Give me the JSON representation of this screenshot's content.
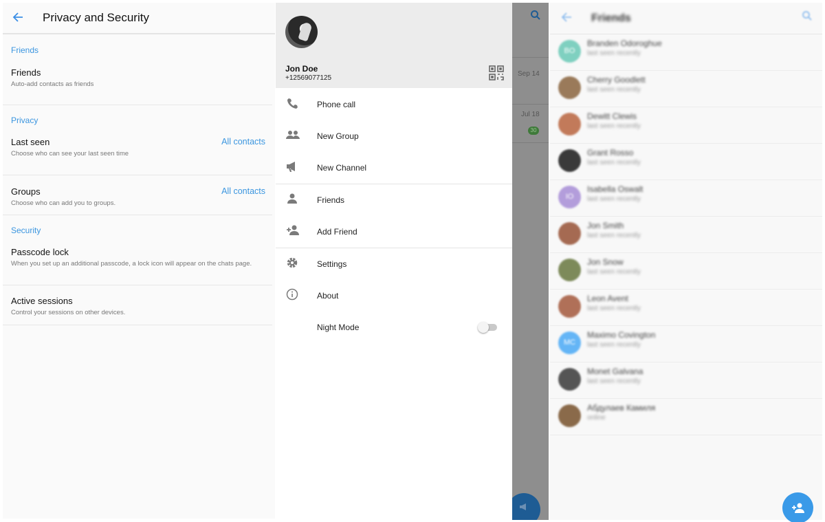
{
  "privacy": {
    "title": "Privacy and Security",
    "sections": [
      {
        "label": "Friends"
      },
      {
        "label": "Privacy"
      },
      {
        "label": "Security"
      }
    ],
    "rows": [
      {
        "title": "Friends",
        "subtitle": "Auto-add contacts as friends",
        "value": ""
      },
      {
        "title": "Last seen",
        "subtitle": "Choose who can see your last seen time",
        "value": "All contacts"
      },
      {
        "title": "Groups",
        "subtitle": "Choose who can add you to groups.",
        "value": "All contacts"
      },
      {
        "title": "Passcode lock",
        "subtitle": "When you set up an additional passcode, a lock icon will appear on the chats page.",
        "value": ""
      },
      {
        "title": "Active sessions",
        "subtitle": "Control your sessions on other devices.",
        "value": ""
      }
    ],
    "accent_color": "#3a95df"
  },
  "drawer": {
    "user_name": "Jon Doe",
    "user_phone": "+12569077125",
    "items": [
      {
        "label": "Phone call",
        "icon": "phone-icon"
      },
      {
        "label": "New Group",
        "icon": "group-icon"
      },
      {
        "label": "New Channel",
        "icon": "megaphone-icon"
      },
      {
        "label": "Friends",
        "icon": "person-icon"
      },
      {
        "label": "Add Friend",
        "icon": "add-person-icon"
      },
      {
        "label": "Settings",
        "icon": "gear-icon"
      },
      {
        "label": "About",
        "icon": "info-icon"
      },
      {
        "label": "Night Mode",
        "icon": "moon-icon"
      }
    ],
    "night_mode_on": false,
    "background_chat": {
      "dates": [
        "Sep 14",
        "Jul 18"
      ],
      "badge": "30"
    }
  },
  "friends": {
    "title": "Friends",
    "items": [
      {
        "name": "Branden Odoroghue",
        "status": "last seen recently",
        "initials": "BO",
        "color": "#7fd0c0"
      },
      {
        "name": "Cherry Goodlett",
        "status": "last seen recently",
        "initials": "",
        "color": "#9a7a5a"
      },
      {
        "name": "Dewitt Clewis",
        "status": "last seen recently",
        "initials": "",
        "color": "#c27a5a"
      },
      {
        "name": "Grant Rosso",
        "status": "last seen recently",
        "initials": "",
        "color": "#3a3a3a"
      },
      {
        "name": "Isabella Oswalt",
        "status": "last seen recently",
        "initials": "IO",
        "color": "#b39ddb"
      },
      {
        "name": "Jon Smith",
        "status": "last seen recently",
        "initials": "",
        "color": "#a56a52"
      },
      {
        "name": "Jon Snow",
        "status": "last seen recently",
        "initials": "",
        "color": "#7d8a5a"
      },
      {
        "name": "Leon Avent",
        "status": "last seen recently",
        "initials": "",
        "color": "#b07058"
      },
      {
        "name": "Maximo Covington",
        "status": "last seen recently",
        "initials": "MC",
        "color": "#64b5f6"
      },
      {
        "name": "Monet Galvana",
        "status": "last seen recently",
        "initials": "",
        "color": "#555555"
      },
      {
        "name": "Абдулаев Камиля",
        "status": "online",
        "initials": "",
        "color": "#8a6a4a"
      }
    ],
    "fab_icon": "add-person-icon",
    "fab_color": "#3a9ae8"
  }
}
